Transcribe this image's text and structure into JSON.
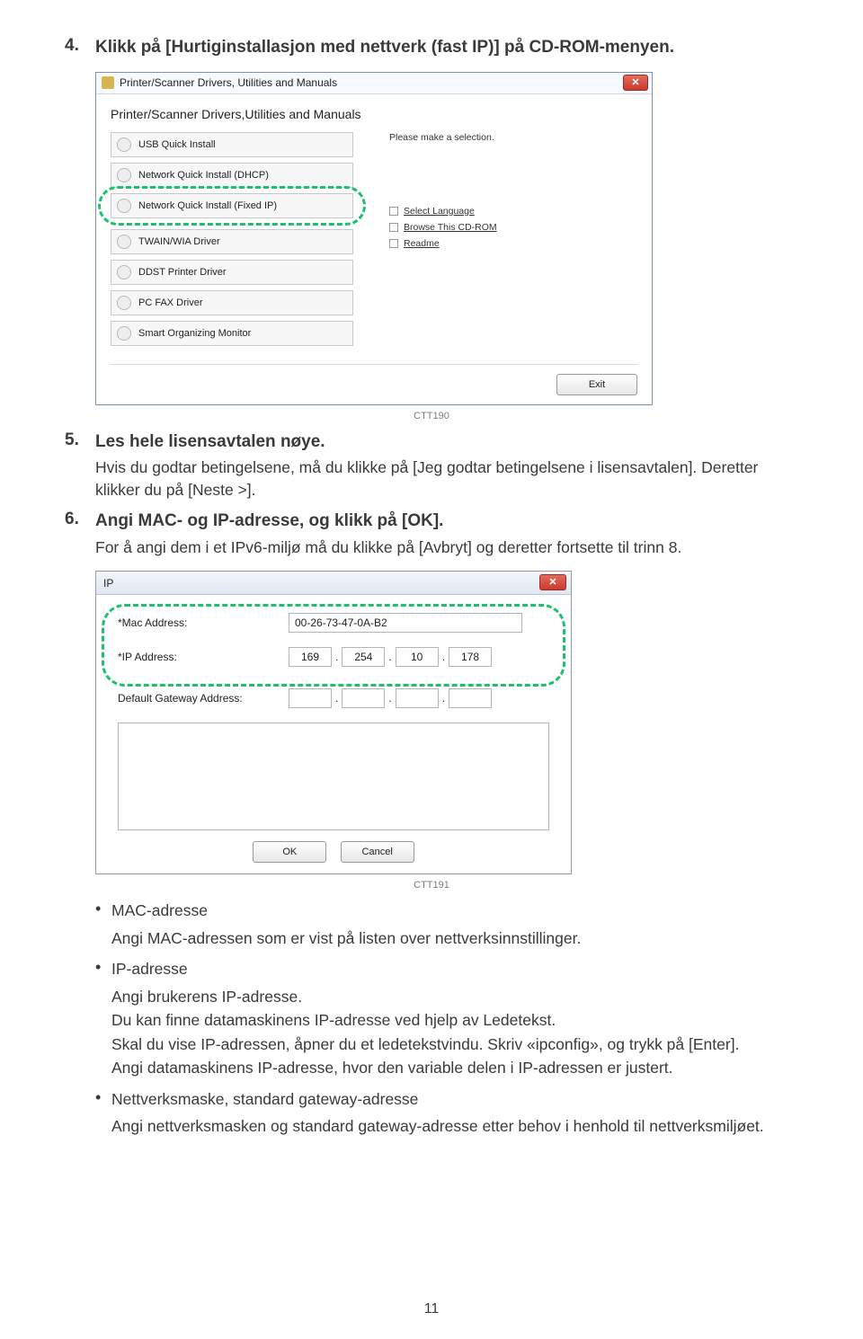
{
  "step4": {
    "num": "4.",
    "text": "Klikk på [Hurtiginstallasjon med nettverk (fast IP)] på CD-ROM-menyen."
  },
  "installer": {
    "titlebar": "Printer/Scanner Drivers, Utilities and Manuals",
    "heading": "Printer/Scanner Drivers,Utilities and Manuals",
    "options": {
      "usb": "USB Quick Install",
      "dhcp": "Network Quick Install (DHCP)",
      "fixed": "Network Quick Install (Fixed IP)",
      "twain": "TWAIN/WIA Driver",
      "ddst": "DDST Printer Driver",
      "pcfax": "PC FAX Driver",
      "som": "Smart Organizing Monitor"
    },
    "right": {
      "selection": "Please make a selection.",
      "lang": "Select Language",
      "browse": "Browse This CD-ROM",
      "readme": "Readme"
    },
    "exit": "Exit",
    "close": "✕",
    "code": "CTT190"
  },
  "step5": {
    "num": "5.",
    "lead": "Les hele lisensavtalen nøye.",
    "body": "Hvis du godtar betingelsene, må du klikke på [Jeg godtar betingelsene i lisensavtalen]. Deretter klikker du på [Neste >]."
  },
  "step6": {
    "num": "6.",
    "lead": "Angi MAC- og IP-adresse, og klikk på [OK].",
    "body": "For å angi dem i et IPv6-miljø må du klikke på [Avbryt] og deretter fortsette til trinn 8."
  },
  "ipdlg": {
    "title": "IP",
    "close": "✕",
    "mac_label": "*Mac Address:",
    "mac_value": "00-26-73-47-0A-B2",
    "ip_label": "*IP Address:",
    "ip": {
      "o1": "169",
      "o2": "254",
      "o3": "10",
      "o4": "178"
    },
    "gw_label": "Default Gateway Address:",
    "gw": {
      "o1": "",
      "o2": "",
      "o3": "",
      "o4": ""
    },
    "ok": "OK",
    "cancel": "Cancel",
    "code": "CTT191"
  },
  "bullets": {
    "mac": {
      "title": "MAC-adresse",
      "body": "Angi MAC-adressen som er vist på listen over nettverksinnstillinger."
    },
    "ip": {
      "title": "IP-adresse",
      "l1": "Angi brukerens IP-adresse.",
      "l2": "Du kan finne datamaskinens IP-adresse ved hjelp av Ledetekst.",
      "l3": "Skal du vise IP-adressen, åpner du et ledetekstvindu. Skriv «ipconfig», og trykk på [Enter].",
      "l4": "Angi datamaskinens IP-adresse, hvor den variable delen i IP-adressen er justert."
    },
    "mask": {
      "title": "Nettverksmaske, standard gateway-adresse",
      "body": "Angi nettverksmasken og standard gateway-adresse etter behov i henhold til nettverksmiljøet."
    }
  },
  "page": "11"
}
